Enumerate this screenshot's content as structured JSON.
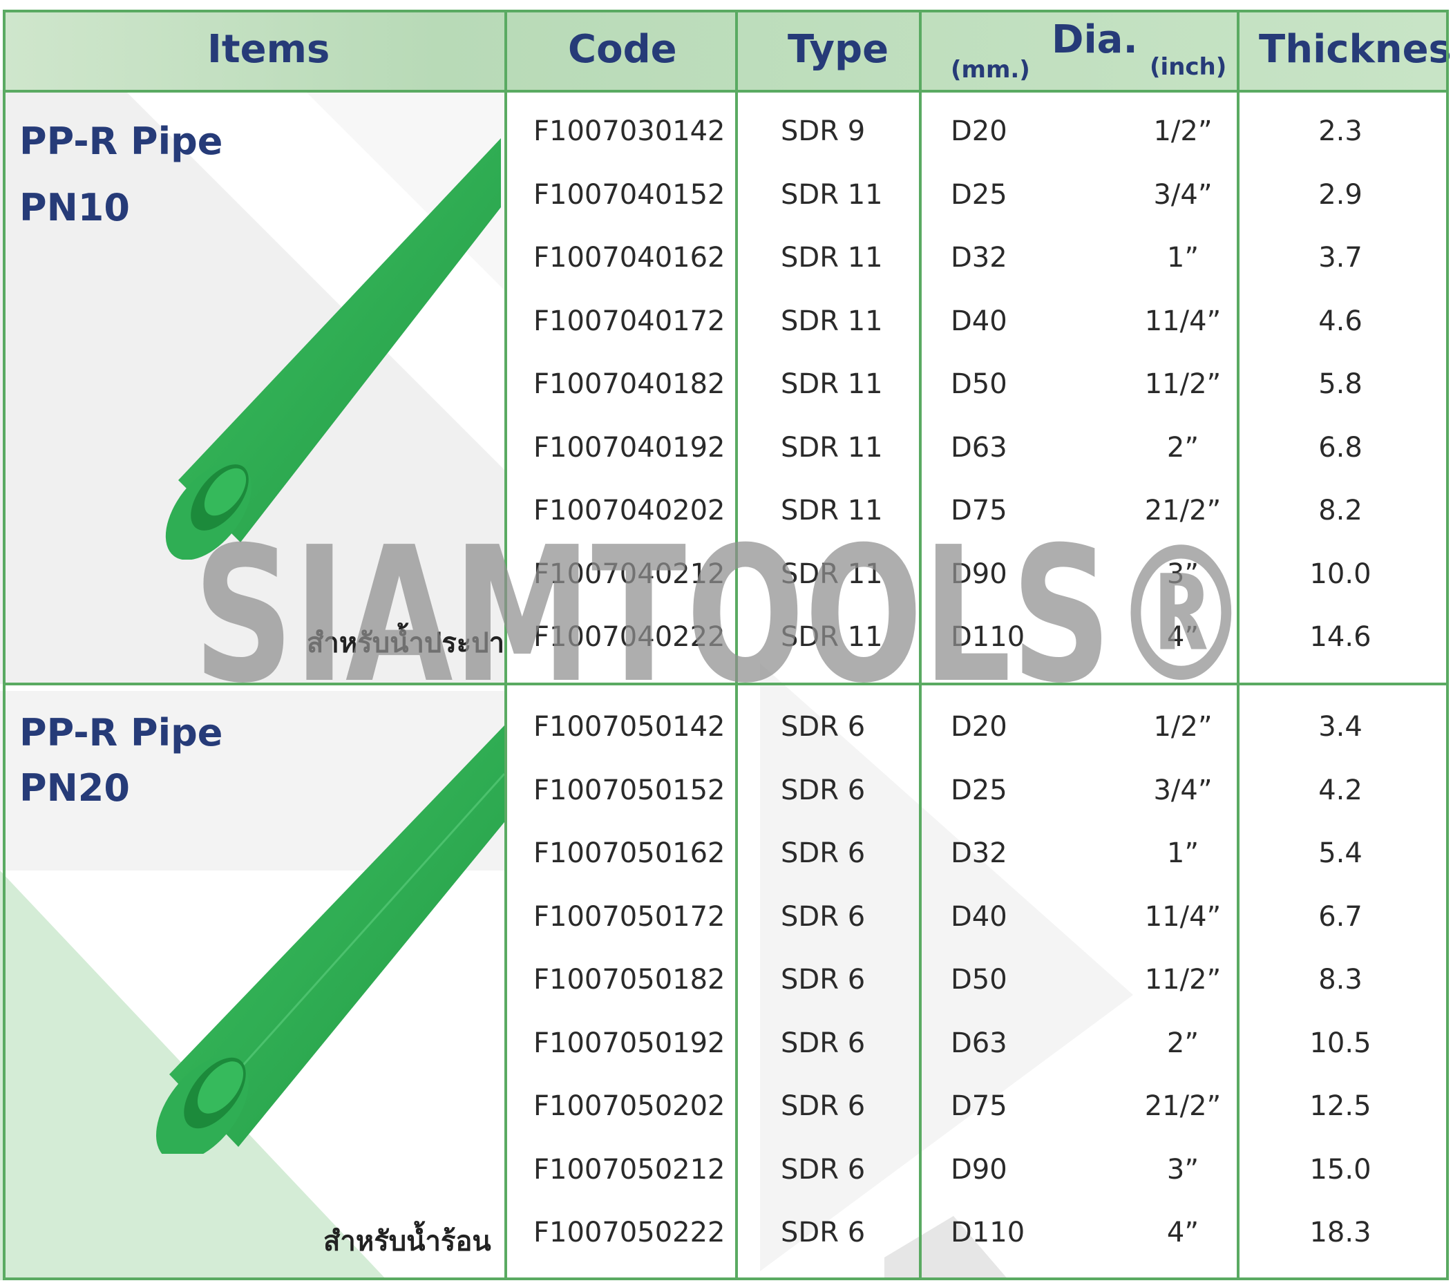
{
  "header": {
    "items": "Items",
    "code": "Code",
    "type": "Type",
    "dia": "Dia.",
    "dia_mm": "(mm.)",
    "dia_inch": "(inch)",
    "thickness": "Thickness"
  },
  "sections": [
    {
      "title_line1": "PP-R Pipe",
      "title_line2": "PN10",
      "purpose": "สำหรับน้ำประปา",
      "rows": [
        {
          "code": "F1007030142",
          "type": "SDR 9",
          "dmm": "D20",
          "inch": "1/2”",
          "thk": "2.3"
        },
        {
          "code": "F1007040152",
          "type": "SDR 11",
          "dmm": "D25",
          "inch": "3/4”",
          "thk": "2.9"
        },
        {
          "code": "F1007040162",
          "type": "SDR 11",
          "dmm": "D32",
          "inch": "1”",
          "thk": "3.7"
        },
        {
          "code": "F1007040172",
          "type": "SDR 11",
          "dmm": "D40",
          "inch": "11/4”",
          "thk": "4.6"
        },
        {
          "code": "F1007040182",
          "type": "SDR 11",
          "dmm": "D50",
          "inch": "11/2”",
          "thk": "5.8"
        },
        {
          "code": "F1007040192",
          "type": "SDR 11",
          "dmm": "D63",
          "inch": "2”",
          "thk": "6.8"
        },
        {
          "code": "F1007040202",
          "type": "SDR 11",
          "dmm": "D75",
          "inch": "21/2”",
          "thk": "8.2"
        },
        {
          "code": "F1007040212",
          "type": "SDR 11",
          "dmm": "D90",
          "inch": "3”",
          "thk": "10.0"
        },
        {
          "code": "F1007040222",
          "type": "SDR 11",
          "dmm": "D110",
          "inch": "4”",
          "thk": "14.6"
        }
      ]
    },
    {
      "title_line1": "PP-R Pipe",
      "title_line2": "PN20",
      "purpose": "สำหรับน้ำร้อน",
      "rows": [
        {
          "code": "F1007050142",
          "type": "SDR 6",
          "dmm": "D20",
          "inch": "1/2”",
          "thk": "3.4"
        },
        {
          "code": "F1007050152",
          "type": "SDR 6",
          "dmm": "D25",
          "inch": "3/4”",
          "thk": "4.2"
        },
        {
          "code": "F1007050162",
          "type": "SDR 6",
          "dmm": "D32",
          "inch": "1”",
          "thk": "5.4"
        },
        {
          "code": "F1007050172",
          "type": "SDR 6",
          "dmm": "D40",
          "inch": "11/4”",
          "thk": "6.7"
        },
        {
          "code": "F1007050182",
          "type": "SDR 6",
          "dmm": "D50",
          "inch": "11/2”",
          "thk": "8.3"
        },
        {
          "code": "F1007050192",
          "type": "SDR 6",
          "dmm": "D63",
          "inch": "2”",
          "thk": "10.5"
        },
        {
          "code": "F1007050202",
          "type": "SDR 6",
          "dmm": "D75",
          "inch": "21/2”",
          "thk": "12.5"
        },
        {
          "code": "F1007050212",
          "type": "SDR 6",
          "dmm": "D90",
          "inch": "3”",
          "thk": "15.0"
        },
        {
          "code": "F1007050222",
          "type": "SDR 6",
          "dmm": "D110",
          "inch": "4”",
          "thk": "18.3"
        }
      ]
    }
  ],
  "watermark": "SIAMTOOLS®",
  "colors": {
    "grid": "#5aaa62",
    "header_bg": "#c4e1c2",
    "heading_text": "#263b78",
    "pipe": "#33b457"
  },
  "icons": [
    "pp-r-pipe-pn10-illustration",
    "pp-r-pipe-pn20-illustration"
  ]
}
